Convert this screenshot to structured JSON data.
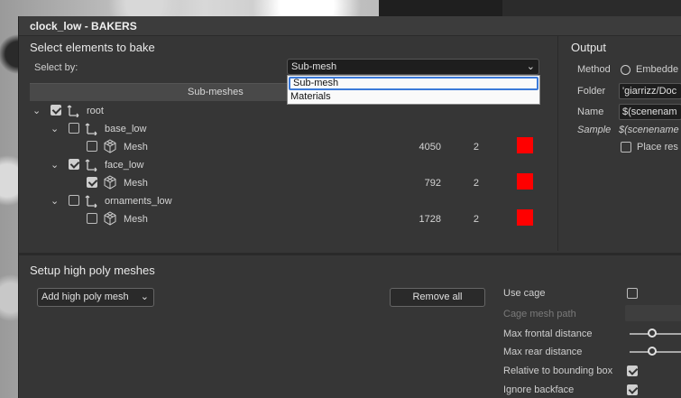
{
  "window": {
    "title": "clock_low - BAKERS"
  },
  "select_panel": {
    "title": "Select elements to bake",
    "select_by_label": "Select by:",
    "select_by_value": "Sub-mesh",
    "dropdown_options": [
      "Sub-mesh",
      "Materials"
    ],
    "column_header": "Sub-meshes"
  },
  "tree": {
    "root": {
      "label": "root",
      "checked": true
    },
    "nodes": [
      {
        "label": "base_low",
        "checked": false,
        "mesh": {
          "label": "Mesh",
          "checked": false,
          "count": "4050",
          "uv": "2",
          "color": "#ff0000"
        }
      },
      {
        "label": "face_low",
        "checked": true,
        "mesh": {
          "label": "Mesh",
          "checked": true,
          "count": "792",
          "uv": "2",
          "color": "#ff0000"
        }
      },
      {
        "label": "ornaments_low",
        "checked": false,
        "mesh": {
          "label": "Mesh",
          "checked": false,
          "count": "1728",
          "uv": "2",
          "color": "#ff0000"
        }
      }
    ]
  },
  "output": {
    "title": "Output",
    "method_label": "Method",
    "method_option": "Embedde",
    "folder_label": "Folder",
    "folder_value": "'giarrizz/Doc",
    "name_label": "Name",
    "name_value": "$(scenenam",
    "sample_label": "Sample",
    "sample_value": "$(scenename",
    "place_label": "Place res"
  },
  "high_poly": {
    "title": "Setup high poly meshes",
    "add_button": "Add high poly mesh",
    "remove_button": "Remove all",
    "use_cage_label": "Use cage",
    "cage_mesh_path_label": "Cage mesh path",
    "max_frontal_label": "Max frontal distance",
    "max_rear_label": "Max rear distance",
    "relative_bbox_label": "Relative to bounding box",
    "ignore_backface_label": "Ignore backface"
  },
  "colors": {
    "swatch": "#ff0000",
    "panel": "#363636",
    "highlight": "#3b7ad9"
  }
}
